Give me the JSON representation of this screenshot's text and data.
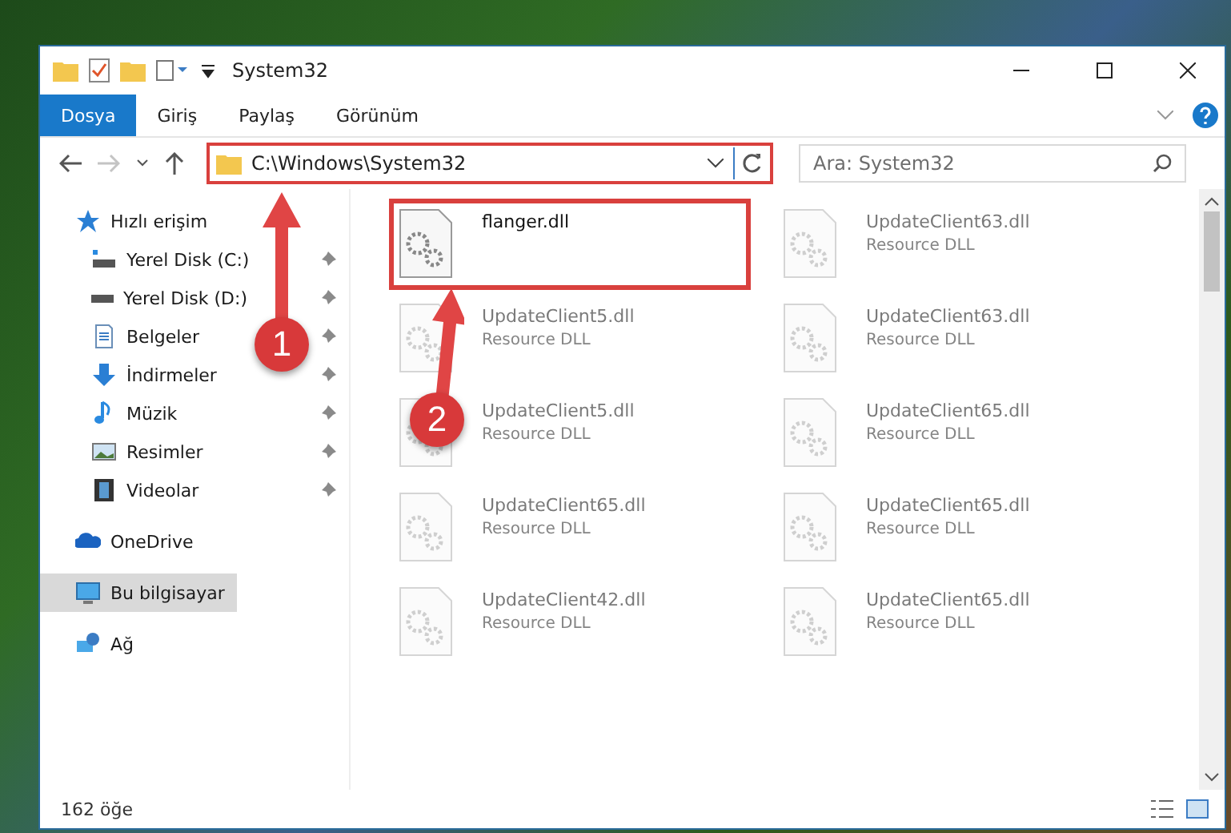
{
  "window": {
    "title": "System32"
  },
  "ribbon_tabs": [
    {
      "label": "Dosya",
      "selected": true
    },
    {
      "label": "Giriş",
      "selected": false
    },
    {
      "label": "Paylaş",
      "selected": false
    },
    {
      "label": "Görünüm",
      "selected": false
    }
  ],
  "address": {
    "path": "C:\\Windows\\System32",
    "highlighted": true
  },
  "search": {
    "placeholder": "Ara: System32"
  },
  "sidebar": {
    "items": [
      {
        "label": "Hızlı erişim",
        "kind": "quick",
        "selected": false,
        "children": [
          {
            "label": "Yerel Disk (C:)",
            "kind": "drive-c",
            "pinned": true,
            "selected": false
          },
          {
            "label": "Yerel Disk (D:)",
            "kind": "drive",
            "pinned": true,
            "selected": false
          },
          {
            "label": "Belgeler",
            "kind": "documents",
            "pinned": true,
            "selected": false
          },
          {
            "label": "İndirmeler",
            "kind": "downloads",
            "pinned": true,
            "selected": false
          },
          {
            "label": "Müzik",
            "kind": "music",
            "pinned": true,
            "selected": false
          },
          {
            "label": "Resimler",
            "kind": "pictures",
            "pinned": true,
            "selected": false
          },
          {
            "label": "Videolar",
            "kind": "videos",
            "pinned": true,
            "selected": false
          }
        ]
      },
      {
        "label": "OneDrive",
        "kind": "cloud",
        "selected": false
      },
      {
        "label": "Bu bilgisayar",
        "kind": "computer",
        "selected": true
      },
      {
        "label": "Ağ",
        "kind": "network",
        "selected": false
      }
    ]
  },
  "files": [
    {
      "name": "flanger.dll",
      "highlighted": true,
      "faded": false
    },
    {
      "name": "UpdateClient63.dll",
      "type": "Resource DLL",
      "highlighted": false,
      "faded": true
    },
    {
      "name": "UpdateClient5.dll",
      "type": "Resource DLL",
      "highlighted": false,
      "faded": true
    },
    {
      "name": "UpdateClient63.dll",
      "type": "Resource DLL",
      "highlighted": false,
      "faded": true
    },
    {
      "name": "UpdateClient5.dll",
      "type": "Resource DLL",
      "highlighted": false,
      "faded": true
    },
    {
      "name": "UpdateClient65.dll",
      "type": "Resource DLL",
      "highlighted": false,
      "faded": true
    },
    {
      "name": "UpdateClient65.dll",
      "type": "Resource DLL",
      "highlighted": false,
      "faded": true
    },
    {
      "name": "UpdateClient65.dll",
      "type": "Resource DLL",
      "highlighted": false,
      "faded": true
    },
    {
      "name": "UpdateClient42.dll",
      "type": "Resource DLL",
      "highlighted": false,
      "faded": true
    },
    {
      "name": "UpdateClient65.dll",
      "type": "Resource DLL",
      "highlighted": false,
      "faded": true
    }
  ],
  "status_bar": {
    "count": "162 öğe"
  },
  "callouts": [
    {
      "number": "1"
    },
    {
      "number": "2"
    }
  ]
}
